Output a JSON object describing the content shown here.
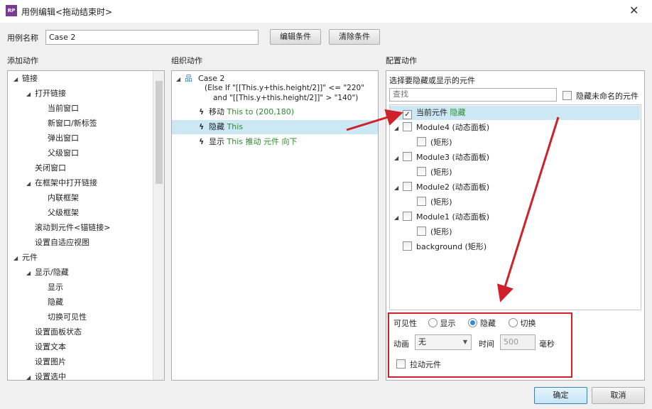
{
  "window": {
    "title": "用例编辑<拖动结束时>",
    "logo": "RP",
    "close": "✕"
  },
  "case": {
    "label": "用例名称",
    "value": "Case 2",
    "edit_btn": "编辑条件",
    "clear_btn": "清除条件"
  },
  "headers": {
    "add": "添加动作",
    "organize": "组织动作",
    "configure": "配置动作"
  },
  "add_tree": [
    {
      "label": "链接",
      "level": 0,
      "exp": true
    },
    {
      "label": "打开链接",
      "level": 1,
      "exp": true
    },
    {
      "label": "当前窗口",
      "level": 2
    },
    {
      "label": "新窗口/新标签",
      "level": 2
    },
    {
      "label": "弹出窗口",
      "level": 2
    },
    {
      "label": "父级窗口",
      "level": 2
    },
    {
      "label": "关闭窗口",
      "level": 1
    },
    {
      "label": "在框架中打开链接",
      "level": 1,
      "exp": true
    },
    {
      "label": "内联框架",
      "level": 2
    },
    {
      "label": "父级框架",
      "level": 2
    },
    {
      "label": "滚动到元件<锚链接>",
      "level": 1
    },
    {
      "label": "设置自适应视图",
      "level": 1
    },
    {
      "label": "元件",
      "level": 0,
      "exp": true
    },
    {
      "label": "显示/隐藏",
      "level": 1,
      "exp": true
    },
    {
      "label": "显示",
      "level": 2
    },
    {
      "label": "隐藏",
      "level": 2
    },
    {
      "label": "切换可见性",
      "level": 2
    },
    {
      "label": "设置面板状态",
      "level": 1
    },
    {
      "label": "设置文本",
      "level": 1
    },
    {
      "label": "设置图片",
      "level": 1
    },
    {
      "label": "设置选中",
      "level": 1,
      "exp": true
    }
  ],
  "organize": {
    "case_name": "Case 2",
    "cond1": "(Else If \"[[This.y+this.height/2]]\" <= \"220\"",
    "cond2": "and \"[[This.y+this.height/2]]\" > \"140\")",
    "actions": [
      {
        "verb": "移动",
        "detail": "This to (200,180)"
      },
      {
        "verb": "隐藏",
        "detail": "This",
        "selected": true
      },
      {
        "verb": "显示",
        "detail": "This 推动 元件 向下"
      }
    ]
  },
  "configure": {
    "subtitle": "选择要隐藏或显示的元件",
    "search_placeholder": "查找",
    "hide_unnamed": "隐藏未命名的元件",
    "tree": [
      {
        "label": "当前元件",
        "extra": "隐藏",
        "level": 0,
        "checked": true,
        "selected": true
      },
      {
        "label": "Module4 (动态面板)",
        "level": 0,
        "exp": true
      },
      {
        "label": "(矩形)",
        "level": 1
      },
      {
        "label": "Module3 (动态面板)",
        "level": 0,
        "exp": true
      },
      {
        "label": "(矩形)",
        "level": 1
      },
      {
        "label": "Module2 (动态面板)",
        "level": 0,
        "exp": true
      },
      {
        "label": "(矩形)",
        "level": 1
      },
      {
        "label": "Module1 (动态面板)",
        "level": 0,
        "exp": true
      },
      {
        "label": "(矩形)",
        "level": 1
      },
      {
        "label": "background (矩形)",
        "level": 0
      }
    ],
    "visibility_label": "可见性",
    "opt_show": "显示",
    "opt_hide": "隐藏",
    "opt_toggle": "切换",
    "selected_option": "隐藏",
    "anim_label": "动画",
    "anim_value": "无",
    "time_label": "时间",
    "time_value": "500",
    "ms_label": "毫秒",
    "drag_label": "拉动元件"
  },
  "buttons": {
    "ok": "确定",
    "cancel": "取消"
  },
  "colors": {
    "annotation": "#d0212a",
    "selection": "#cce8f4",
    "action_green": "#2e8b2e"
  }
}
